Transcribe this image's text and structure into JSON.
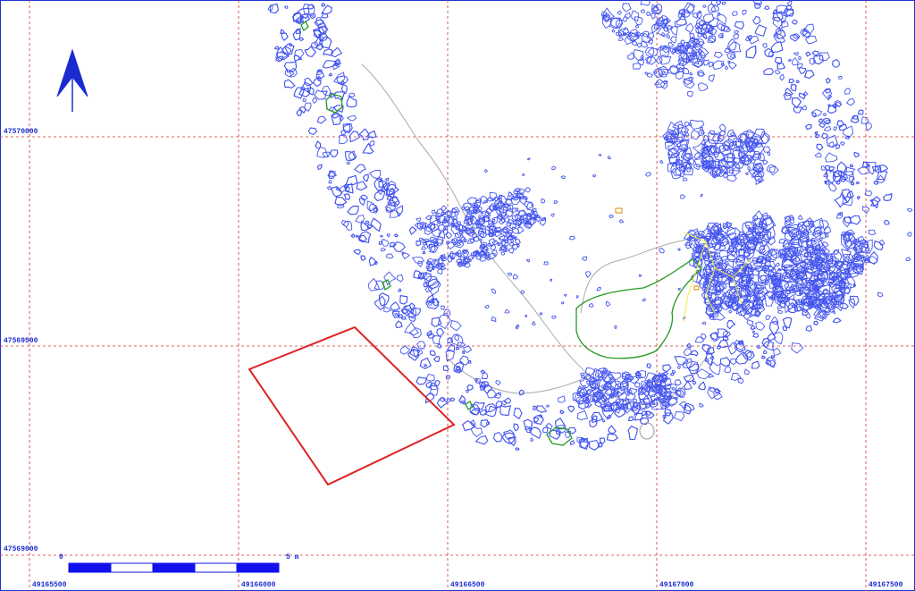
{
  "map": {
    "grid_x_labels": [
      "49165500",
      "49166000",
      "49166500",
      "49167000",
      "49167500"
    ],
    "grid_y_labels": [
      "47570000",
      "47569500",
      "47569000"
    ],
    "north_arrow": "north-arrow-icon",
    "scale_bar": {
      "start_label": "0",
      "end_label": "5 m",
      "segments": 5
    },
    "colors": {
      "frame": "#2233cc",
      "grid": "#cc3333",
      "rock_outline": "#4455ee",
      "vegetation": "#229922",
      "track": "#aaaaaa",
      "zone": "#eeee44",
      "survey_area": "#dd2222",
      "scale_fill": "#1111ee",
      "coord_text": "#1a2bd0"
    }
  }
}
